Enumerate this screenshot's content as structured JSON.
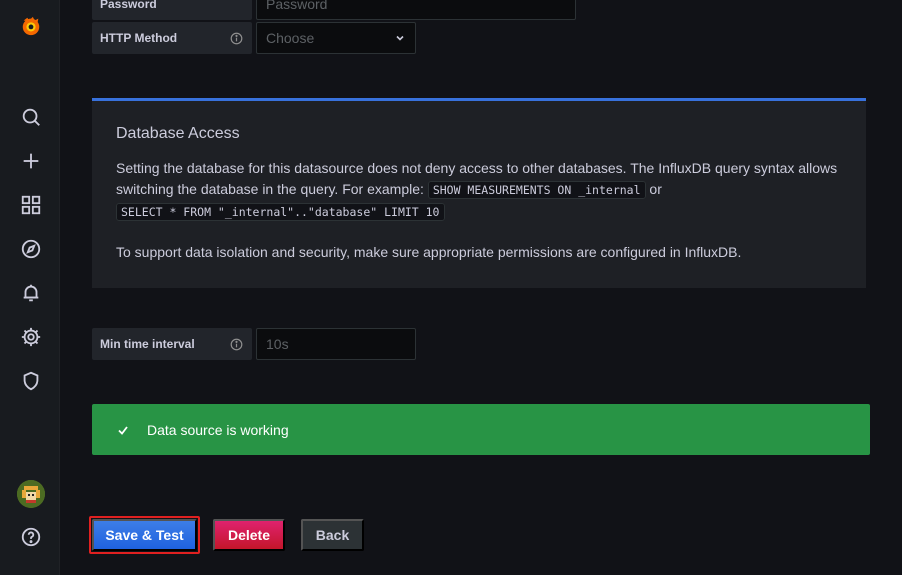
{
  "sidebar": {
    "icons": [
      "grafana-logo-icon",
      "search-icon",
      "plus-icon",
      "dashboards-icon",
      "explore-icon",
      "alerting-icon",
      "configuration-icon",
      "shield-icon",
      "help-icon"
    ]
  },
  "fields": {
    "password": {
      "label": "Password",
      "placeholder": "Password"
    },
    "http_method": {
      "label": "HTTP Method",
      "placeholder": "Choose"
    },
    "min_time_interval": {
      "label": "Min time interval",
      "placeholder": "10s"
    }
  },
  "database_access": {
    "title": "Database Access",
    "text_1": "Setting the database for this datasource does not deny access to other databases. The InfluxDB query syntax allows switching the database in the query. For example:",
    "code_1": "SHOW MEASUREMENTS ON _internal",
    "or": "or",
    "code_2": "SELECT * FROM \"_internal\"..\"database\" LIMIT 10",
    "text_2": "To support data isolation and security, make sure appropriate permissions are configured in InfluxDB."
  },
  "alert": {
    "message": "Data source is working",
    "color": "#289445"
  },
  "buttons": {
    "save": "Save & Test",
    "delete": "Delete",
    "back": "Back"
  },
  "colors": {
    "accent": "#3871dc",
    "danger": "#e0226e",
    "success": "#289445"
  }
}
